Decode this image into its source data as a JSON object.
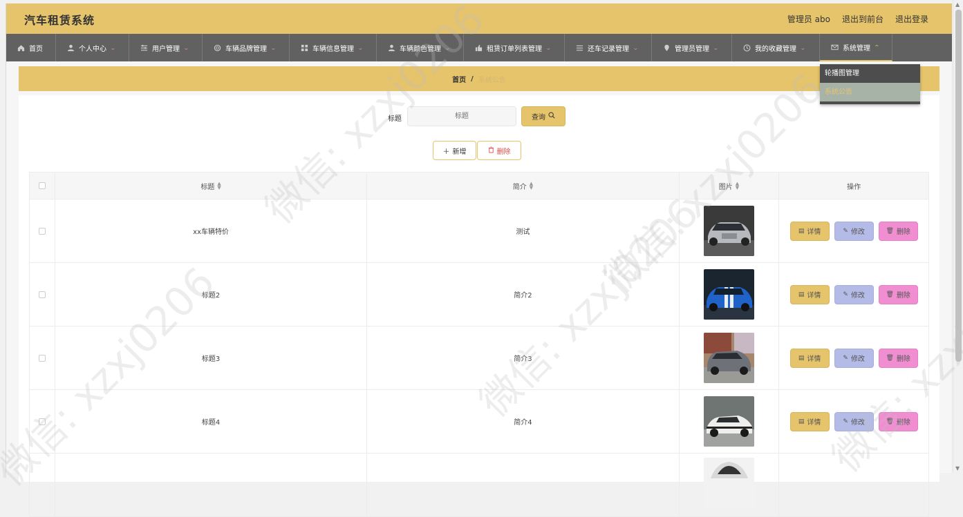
{
  "header": {
    "title": "汽车租赁系统",
    "user_label": "管理员 abo",
    "to_front": "退出到前台",
    "logout": "退出登录"
  },
  "nav": [
    {
      "label": "首页",
      "icon": "home-icon"
    },
    {
      "label": "个人中心",
      "icon": "user-icon"
    },
    {
      "label": "用户管理",
      "icon": "sliders-icon"
    },
    {
      "label": "车辆品牌管理",
      "icon": "circle-icon"
    },
    {
      "label": "车辆信息管理",
      "icon": "grid-icon"
    },
    {
      "label": "车辆颜色管理",
      "icon": "user-icon"
    },
    {
      "label": "租赁订单列表管理",
      "icon": "thumb-icon"
    },
    {
      "label": "还车记录管理",
      "icon": "list-icon"
    },
    {
      "label": "管理员管理",
      "icon": "pin-icon"
    },
    {
      "label": "我的收藏管理",
      "icon": "clock-icon"
    },
    {
      "label": "系统管理",
      "icon": "mail-icon"
    }
  ],
  "dropdown": {
    "items": [
      "轮播图管理",
      "系统公告"
    ]
  },
  "breadcrumb": {
    "home": "首页",
    "separator": "/",
    "current": "系统公告"
  },
  "search": {
    "label": "标题",
    "placeholder": "标题",
    "button": "查询"
  },
  "actions": {
    "add": "新增",
    "delete": "删除"
  },
  "table": {
    "headers": {
      "title": "标题",
      "intro": "简介",
      "image": "图片",
      "ops": "操作"
    },
    "rows": [
      {
        "title": "xx车辆特价",
        "intro": "测试",
        "image": "silver-sedan"
      },
      {
        "title": "标题2",
        "intro": "简介2",
        "image": "blue-sports-car"
      },
      {
        "title": "标题3",
        "intro": "简介3",
        "image": "gray-minivan"
      },
      {
        "title": "标题4",
        "intro": "简介4",
        "image": "white-coupe"
      }
    ],
    "op_labels": {
      "detail": "详情",
      "edit": "修改",
      "delete": "删除"
    }
  },
  "colors": {
    "accent": "#e6c46c",
    "nav_bg": "#616161",
    "edit_btn": "#b4bbe6",
    "delete_btn": "#f08ed1"
  },
  "watermark": "微信: xzxj0206"
}
